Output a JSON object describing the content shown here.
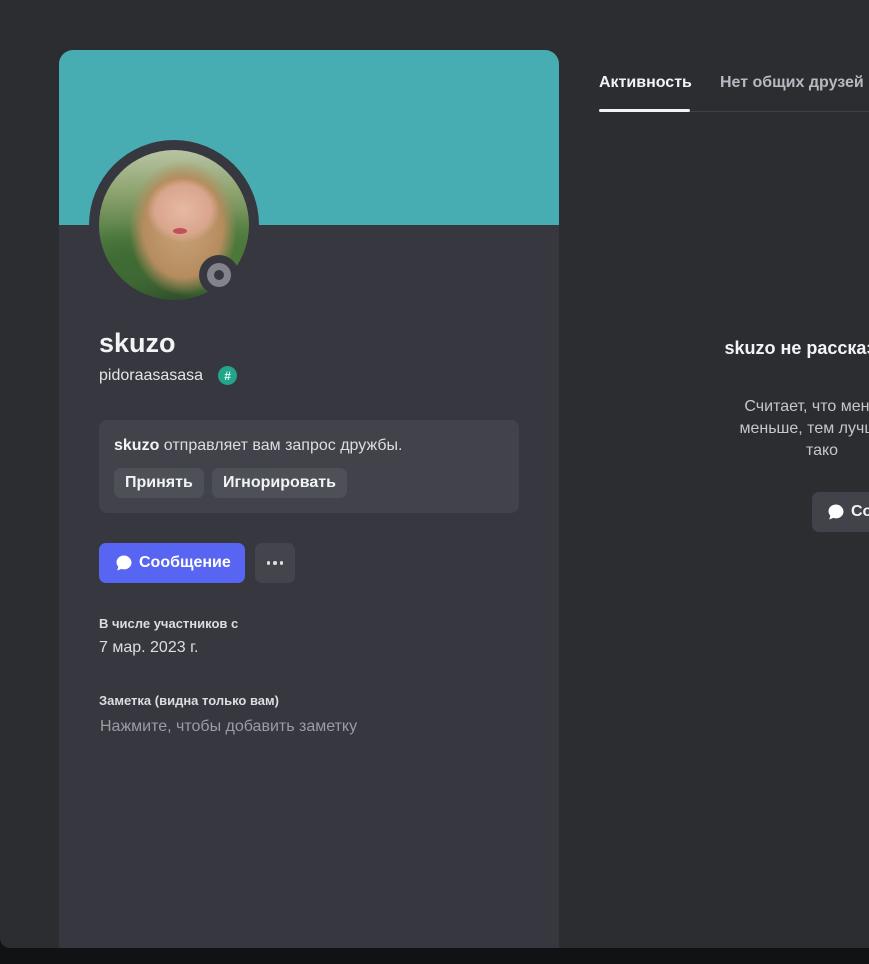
{
  "profile": {
    "display_name": "skuzo",
    "username": "pidoraasasasa",
    "badge": "#",
    "banner_color": "#47adb2",
    "status": "offline"
  },
  "friend_request": {
    "name": "skuzo",
    "text": " отправляет вам запрос дружбы.",
    "accept_label": "Принять",
    "ignore_label": "Игнорировать"
  },
  "actions": {
    "message_label": "Сообщение",
    "more_icon": "more-dots-icon",
    "accent_color": "#5865f2"
  },
  "member_since": {
    "label": "В числе участников с",
    "date": "7 мар. 2023 г."
  },
  "note": {
    "label": "Заметка (видна только вам)",
    "placeholder": "Нажмите, чтобы добавить заметку"
  },
  "tabs": [
    {
      "label": "Активность",
      "active": true
    },
    {
      "label": "Нет общих друзей",
      "active": false
    }
  ],
  "activity_empty": {
    "title": "skuzo не рассказ акти",
    "subtitle_1": "Считает, что меньше",
    "subtitle_2": "меньше, тем лучше",
    "subtitle_3": "тако",
    "button_label": "Со"
  }
}
